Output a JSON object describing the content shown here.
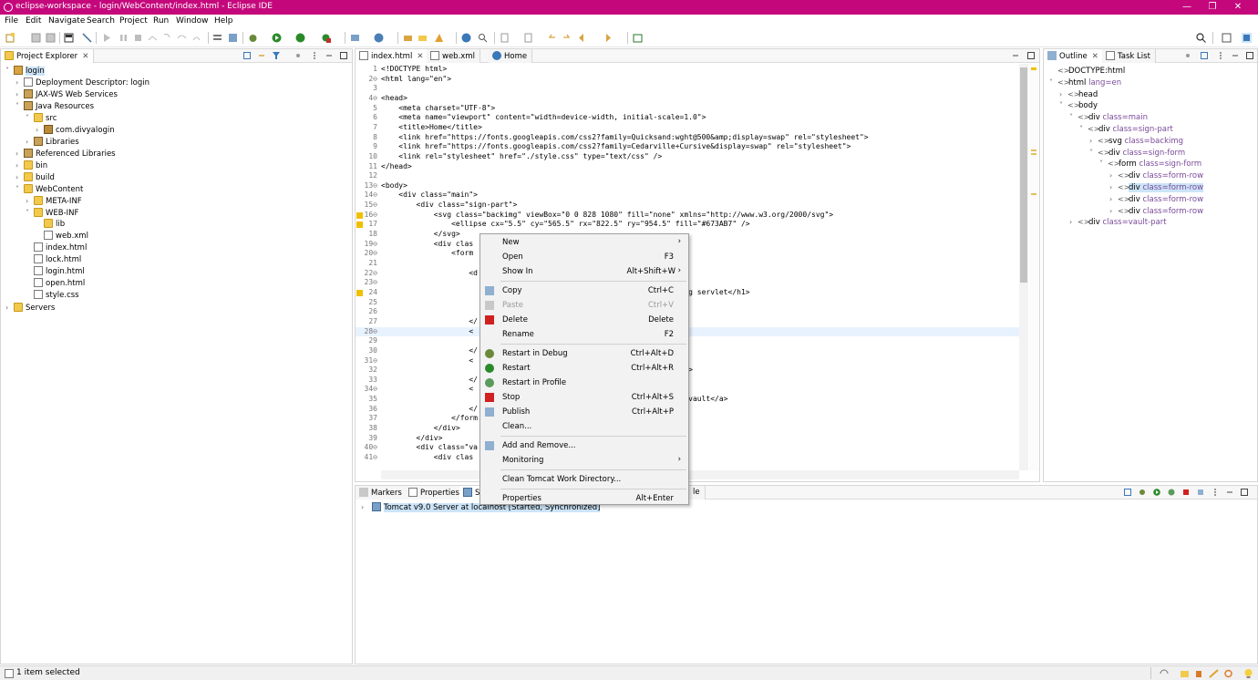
{
  "window": {
    "title": "eclipse-workspace - login/WebContent/index.html - Eclipse IDE"
  },
  "menu": [
    "File",
    "Edit",
    "Navigate",
    "Search",
    "Project",
    "Run",
    "Window",
    "Help"
  ],
  "colors": {
    "titlebar": "#c4087c",
    "selection": "#cce4f7",
    "highlight_line": "#e8f2fe"
  },
  "project_explorer": {
    "tab": "Project Explorer",
    "items": [
      {
        "label": "login",
        "depth": 0,
        "arrow": "v",
        "icon": "project",
        "selected": true
      },
      {
        "label": "Deployment Descriptor: login",
        "depth": 1,
        "arrow": ">",
        "icon": "file"
      },
      {
        "label": "JAX-WS Web Services",
        "depth": 1,
        "arrow": ">",
        "icon": "lib"
      },
      {
        "label": "Java Resources",
        "depth": 1,
        "arrow": "v",
        "icon": "lib"
      },
      {
        "label": "src",
        "depth": 2,
        "arrow": "v",
        "icon": "folder"
      },
      {
        "label": "com.divyalogin",
        "depth": 3,
        "arrow": ">",
        "icon": "pkg"
      },
      {
        "label": "Libraries",
        "depth": 2,
        "arrow": ">",
        "icon": "lib"
      },
      {
        "label": "Referenced Libraries",
        "depth": 1,
        "arrow": ">",
        "icon": "lib"
      },
      {
        "label": "bin",
        "depth": 1,
        "arrow": ">",
        "icon": "folder"
      },
      {
        "label": "build",
        "depth": 1,
        "arrow": ">",
        "icon": "folder"
      },
      {
        "label": "WebContent",
        "depth": 1,
        "arrow": "v",
        "icon": "folder"
      },
      {
        "label": "META-INF",
        "depth": 2,
        "arrow": ">",
        "icon": "folder"
      },
      {
        "label": "WEB-INF",
        "depth": 2,
        "arrow": "v",
        "icon": "folder"
      },
      {
        "label": "lib",
        "depth": 3,
        "arrow": "",
        "icon": "folder"
      },
      {
        "label": "web.xml",
        "depth": 3,
        "arrow": "",
        "icon": "file"
      },
      {
        "label": "index.html",
        "depth": 2,
        "arrow": "",
        "icon": "file"
      },
      {
        "label": "lock.html",
        "depth": 2,
        "arrow": "",
        "icon": "file"
      },
      {
        "label": "login.html",
        "depth": 2,
        "arrow": "",
        "icon": "file"
      },
      {
        "label": "open.html",
        "depth": 2,
        "arrow": "",
        "icon": "file"
      },
      {
        "label": "style.css",
        "depth": 2,
        "arrow": "",
        "icon": "file"
      },
      {
        "label": "Servers",
        "depth": 0,
        "arrow": ">",
        "icon": "folder"
      }
    ]
  },
  "editor": {
    "tabs": [
      "index.html",
      "web.xml",
      "Home"
    ],
    "lines": [
      {
        "n": "1",
        "t": "<!DOCTYPE html>"
      },
      {
        "n": "2⊖",
        "t": "<html lang=\"en\">"
      },
      {
        "n": "3",
        "t": ""
      },
      {
        "n": "4⊖",
        "t": "<head>"
      },
      {
        "n": "5",
        "t": "    <meta charset=\"UTF-8\">"
      },
      {
        "n": "6",
        "t": "    <meta name=\"viewport\" content=\"width=device-width, initial-scale=1.0\">"
      },
      {
        "n": "7",
        "t": "    <title>Home</title>"
      },
      {
        "n": "8",
        "t": "    <link href=\"https://fonts.googleapis.com/css2?family=Quicksand:wght@500&amp;display=swap\" rel=\"stylesheet\">"
      },
      {
        "n": "9",
        "t": "    <link href=\"https://fonts.googleapis.com/css2?family=Cedarville+Cursive&display=swap\" rel=\"stylesheet\">"
      },
      {
        "n": "10",
        "t": "    <link rel=\"stylesheet\" href=\"./style.css\" type=\"text/css\" />"
      },
      {
        "n": "11",
        "t": "</head>"
      },
      {
        "n": "12",
        "t": ""
      },
      {
        "n": "13⊖",
        "t": "<body>"
      },
      {
        "n": "14⊖",
        "t": "    <div class=\"main\">"
      },
      {
        "n": "15⊖",
        "t": "        <div class=\"sign-part\">"
      },
      {
        "n": "16⊖",
        "t": "            <svg class=\"backimg\" viewBox=\"0 0 828 1080\" fill=\"none\" xmlns=\"http://www.w3.org/2000/svg\">",
        "warn": true
      },
      {
        "n": "17",
        "t": "                <ellipse cx=\"5.5\" cy=\"565.5\" rx=\"822.5\" ry=\"954.5\" fill=\"#673AB7\" />",
        "warn": true
      },
      {
        "n": "18",
        "t": "            </svg>"
      },
      {
        "n": "19⊖",
        "t": "            <div clas"
      },
      {
        "n": "20⊖",
        "t": "                <form"
      },
      {
        "n": "21",
        "t": ""
      },
      {
        "n": "22⊖",
        "t": "                    <d"
      },
      {
        "n": "23⊖",
        "t": ""
      },
      {
        "n": "24",
        "t": "                                                            mplementing servlet</h1>",
        "warn": true
      },
      {
        "n": "25",
        "t": ""
      },
      {
        "n": "26",
        "t": ""
      },
      {
        "n": "27",
        "t": "                    </"
      },
      {
        "n": "28⊖",
        "t": "                    <",
        "hl": true
      },
      {
        "n": "29",
        "t": "                                                            in</a>"
      },
      {
        "n": "30",
        "t": "                    </"
      },
      {
        "n": "31⊖",
        "t": "                    <"
      },
      {
        "n": "32",
        "t": "                                                            Log Out</a>"
      },
      {
        "n": "33",
        "t": "                    </"
      },
      {
        "n": "34⊖",
        "t": "                    <"
      },
      {
        "n": "35",
        "t": "                                                            heck your vault</a>"
      },
      {
        "n": "36",
        "t": "                    </"
      },
      {
        "n": "37",
        "t": "                </form"
      },
      {
        "n": "38",
        "t": "            </div>"
      },
      {
        "n": "39",
        "t": "        </div>"
      },
      {
        "n": "40⊖",
        "t": "        <div class=\"va"
      },
      {
        "n": "41⊖",
        "t": "            <div clas"
      }
    ]
  },
  "outline": {
    "tabs": [
      "Outline",
      "Task List"
    ],
    "items": [
      {
        "label": "DOCTYPE:html",
        "attr": "",
        "depth": 0,
        "arrow": ""
      },
      {
        "label": "html",
        "attr": "lang=en",
        "depth": 0,
        "arrow": "v"
      },
      {
        "label": "head",
        "attr": "",
        "depth": 1,
        "arrow": ">"
      },
      {
        "label": "body",
        "attr": "",
        "depth": 1,
        "arrow": "v"
      },
      {
        "label": "div",
        "attr": "class=main",
        "depth": 2,
        "arrow": "v"
      },
      {
        "label": "div",
        "attr": "class=sign-part",
        "depth": 3,
        "arrow": "v"
      },
      {
        "label": "svg",
        "attr": "class=backimg",
        "depth": 4,
        "arrow": ">"
      },
      {
        "label": "div",
        "attr": "class=sign-form",
        "depth": 4,
        "arrow": "v"
      },
      {
        "label": "form",
        "attr": "class=sign-form",
        "depth": 5,
        "arrow": "v"
      },
      {
        "label": "div",
        "attr": "class=form-row",
        "depth": 6,
        "arrow": ">"
      },
      {
        "label": "div",
        "attr": "class=form-row",
        "depth": 6,
        "arrow": ">",
        "selected": true
      },
      {
        "label": "div",
        "attr": "class=form-row",
        "depth": 6,
        "arrow": ">"
      },
      {
        "label": "div",
        "attr": "class=form-row",
        "depth": 6,
        "arrow": ">"
      },
      {
        "label": "div",
        "attr": "class=vault-part",
        "depth": 2,
        "arrow": ">"
      }
    ]
  },
  "bottom": {
    "tabs": [
      "Markers",
      "Properties",
      "Se",
      "le"
    ],
    "server_row": "Tomcat v9.0 Server at localhost  [Started, Synchronized]"
  },
  "context_menu": {
    "items": [
      {
        "type": "item",
        "label": "New",
        "submenu": true
      },
      {
        "type": "item",
        "label": "Open",
        "key": "F3"
      },
      {
        "type": "item",
        "label": "Show In",
        "key": "Alt+Shift+W",
        "submenu": true
      },
      {
        "type": "sep"
      },
      {
        "type": "item",
        "label": "Copy",
        "key": "Ctrl+C",
        "icon": "copy-icon"
      },
      {
        "type": "item",
        "label": "Paste",
        "key": "Ctrl+V",
        "icon": "paste-icon",
        "disabled": true
      },
      {
        "type": "item",
        "label": "Delete",
        "key": "Delete",
        "icon": "delete-icon"
      },
      {
        "type": "item",
        "label": "Rename",
        "key": "F2"
      },
      {
        "type": "sep"
      },
      {
        "type": "item",
        "label": "Restart in Debug",
        "key": "Ctrl+Alt+D",
        "icon": "debug-icon"
      },
      {
        "type": "item",
        "label": "Restart",
        "key": "Ctrl+Alt+R",
        "icon": "run-icon"
      },
      {
        "type": "item",
        "label": "Restart in Profile",
        "icon": "profile-icon"
      },
      {
        "type": "item",
        "label": "Stop",
        "key": "Ctrl+Alt+S",
        "icon": "stop-icon"
      },
      {
        "type": "item",
        "label": "Publish",
        "key": "Ctrl+Alt+P",
        "icon": "publish-icon"
      },
      {
        "type": "item",
        "label": "Clean..."
      },
      {
        "type": "sep"
      },
      {
        "type": "item",
        "label": "Add and Remove...",
        "icon": "add-remove-icon"
      },
      {
        "type": "item",
        "label": "Monitoring",
        "submenu": true
      },
      {
        "type": "sep"
      },
      {
        "type": "item",
        "label": "Clean Tomcat Work Directory..."
      },
      {
        "type": "sep"
      },
      {
        "type": "item",
        "label": "Properties",
        "key": "Alt+Enter"
      }
    ]
  },
  "status": {
    "text": "1 item selected"
  }
}
